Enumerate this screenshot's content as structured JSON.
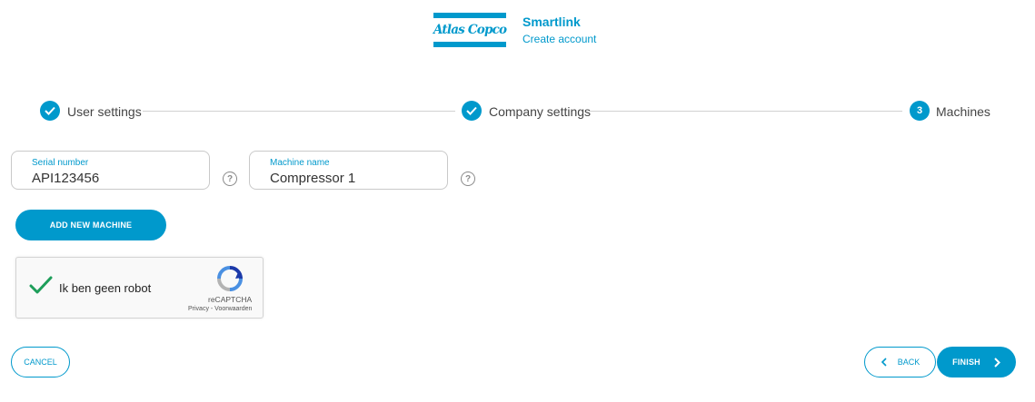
{
  "header": {
    "logo_text": "Atlas Copco",
    "app_title": "Smartlink",
    "app_subtitle": "Create account"
  },
  "stepper": {
    "steps": [
      {
        "label": "User settings",
        "state": "completed"
      },
      {
        "label": "Company settings",
        "state": "completed"
      },
      {
        "label": "Machines",
        "state": "active",
        "number": "3"
      }
    ]
  },
  "form": {
    "serial": {
      "label": "Serial number",
      "value": "API123456"
    },
    "machine_name": {
      "label": "Machine name",
      "value": "Compressor 1"
    },
    "help_glyph": "?",
    "add_button": "ADD NEW MACHINE"
  },
  "captcha": {
    "label": "Ik ben geen robot",
    "brand": "reCAPTCHA",
    "links": "Privacy - Voorwaarden",
    "checked": true
  },
  "footer": {
    "cancel": "CANCEL",
    "back": "BACK",
    "finish": "FINISH"
  },
  "colors": {
    "accent": "#0099cc",
    "check_green": "#1e9e5a"
  }
}
